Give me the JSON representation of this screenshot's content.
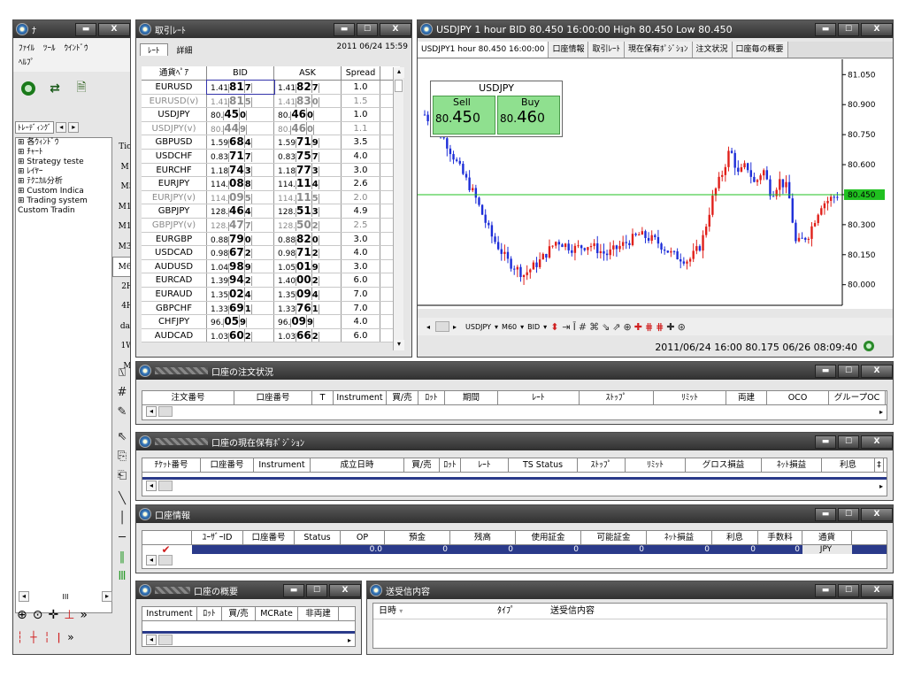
{
  "navigator": {
    "title": "ﾅ",
    "menu": [
      "ﾌｧｲﾙ",
      "ﾂｰﾙ",
      "ｳｲﾝﾄﾞｳ"
    ],
    "menu2": "ﾍﾙﾌﾟ",
    "tab": "ﾄﾚｰﾃﾞｨﾝｸﾞ",
    "tree": [
      "⊞ 各ｳｨﾝﾄﾞｳ",
      "⊞ ﾁｬｰﾄ",
      "⊞ Strategy teste",
      "⊞ ﾚｲﾔｰ",
      "⊞ ﾃｸﾆｶﾙ分析",
      "⊞ Custom Indica",
      "⊞ Trading system",
      "  Custom Tradin"
    ],
    "timeframes": [
      "Tick",
      "M1",
      "M5",
      "M10",
      "M15",
      "M30",
      "M60",
      "2H",
      "4H",
      "day",
      "1W",
      "M"
    ],
    "scroll_label": "III"
  },
  "rates": {
    "title": "取引ﾚｰﾄ",
    "tabs": [
      "ﾚｰﾄ",
      "詳細"
    ],
    "date": "2011 06/24 15:59",
    "headers": [
      "通貨ﾍﾟｱ",
      "BID",
      "ASK",
      "Spread"
    ],
    "rows": [
      {
        "pair": "EURUSD",
        "b1": "1.41",
        "b2": "81",
        "b3": "7",
        "a1": "1.41",
        "a2": "82",
        "a3": "7",
        "spread": "1.0",
        "grey": false
      },
      {
        "pair": "EURUSD(v)",
        "b1": "1.41",
        "b2": "81",
        "b3": "5",
        "a1": "1.41",
        "a2": "83",
        "a3": "0",
        "spread": "1.5",
        "grey": true
      },
      {
        "pair": "USDJPY",
        "b1": "80.",
        "b2": "45",
        "b3": "0",
        "a1": "80.",
        "a2": "46",
        "a3": "0",
        "spread": "1.0",
        "grey": false
      },
      {
        "pair": "USDJPY(v)",
        "b1": "80.",
        "b2": "44",
        "b3": "9",
        "a1": "80.",
        "a2": "46",
        "a3": "0",
        "spread": "1.1",
        "grey": true
      },
      {
        "pair": "GBPUSD",
        "b1": "1.59",
        "b2": "68",
        "b3": "4",
        "a1": "1.59",
        "a2": "71",
        "a3": "9",
        "spread": "3.5",
        "grey": false
      },
      {
        "pair": "USDCHF",
        "b1": "0.83",
        "b2": "71",
        "b3": "7",
        "a1": "0.83",
        "a2": "75",
        "a3": "7",
        "spread": "4.0",
        "grey": false
      },
      {
        "pair": "EURCHF",
        "b1": "1.18",
        "b2": "74",
        "b3": "3",
        "a1": "1.18",
        "a2": "77",
        "a3": "3",
        "spread": "3.0",
        "grey": false
      },
      {
        "pair": "EURJPY",
        "b1": "114.",
        "b2": "08",
        "b3": "8",
        "a1": "114.",
        "a2": "11",
        "a3": "4",
        "spread": "2.6",
        "grey": false
      },
      {
        "pair": "EURJPY(v)",
        "b1": "114.",
        "b2": "09",
        "b3": "5",
        "a1": "114.",
        "a2": "11",
        "a3": "5",
        "spread": "2.0",
        "grey": true
      },
      {
        "pair": "GBPJPY",
        "b1": "128.",
        "b2": "46",
        "b3": "4",
        "a1": "128.",
        "a2": "51",
        "a3": "3",
        "spread": "4.9",
        "grey": false
      },
      {
        "pair": "GBPJPY(v)",
        "b1": "128.",
        "b2": "47",
        "b3": "7",
        "a1": "128.",
        "a2": "50",
        "a3": "2",
        "spread": "2.5",
        "grey": true
      },
      {
        "pair": "EURGBP",
        "b1": "0.88",
        "b2": "79",
        "b3": "0",
        "a1": "0.88",
        "a2": "82",
        "a3": "0",
        "spread": "3.0",
        "grey": false
      },
      {
        "pair": "USDCAD",
        "b1": "0.98",
        "b2": "67",
        "b3": "2",
        "a1": "0.98",
        "a2": "71",
        "a3": "2",
        "spread": "4.0",
        "grey": false
      },
      {
        "pair": "AUDUSD",
        "b1": "1.04",
        "b2": "98",
        "b3": "9",
        "a1": "1.05",
        "a2": "01",
        "a3": "9",
        "spread": "3.0",
        "grey": false
      },
      {
        "pair": "EURCAD",
        "b1": "1.39",
        "b2": "94",
        "b3": "2",
        "a1": "1.40",
        "a2": "00",
        "a3": "2",
        "spread": "6.0",
        "grey": false
      },
      {
        "pair": "EURAUD",
        "b1": "1.35",
        "b2": "02",
        "b3": "4",
        "a1": "1.35",
        "a2": "09",
        "a3": "4",
        "spread": "7.0",
        "grey": false
      },
      {
        "pair": "GBPCHF",
        "b1": "1.33",
        "b2": "69",
        "b3": "1",
        "a1": "1.33",
        "a2": "76",
        "a3": "1",
        "spread": "7.0",
        "grey": false
      },
      {
        "pair": "CHFJPY",
        "b1": "96.",
        "b2": "05",
        "b3": "9",
        "a1": "96.",
        "a2": "09",
        "a3": "9",
        "spread": "4.0",
        "grey": false
      },
      {
        "pair": "AUDCAD",
        "b1": "1.03",
        "b2": "60",
        "b3": "2",
        "a1": "1.03",
        "a2": "66",
        "a3": "2",
        "spread": "6.0",
        "grey": false
      }
    ]
  },
  "chart": {
    "title": "USDJPY 1 hour BID 80.450 16:00:00 High 80.450 Low 80.450",
    "tabs": [
      "USDJPY1 hour 80.450 16:00:00",
      "口座情報",
      "取引ﾚｰﾄ",
      "現在保有ﾎﾟｼﾞｼｮﾝ",
      "注文状況",
      "口座毎の概要"
    ],
    "panel": {
      "symbol": "USDJPY",
      "sell_label": "Sell",
      "buy_label": "Buy",
      "sell_pre": "80.",
      "sell_big": "45",
      "sell_post": "0",
      "buy_pre": "80.",
      "buy_big": "46",
      "buy_post": "0"
    },
    "price_labels": [
      "81.050",
      "80.900",
      "80.750",
      "80.600",
      "80.450",
      "80.300",
      "80.150",
      "80.000"
    ],
    "current_price": "80.450",
    "date_labels": [
      "6.16",
      "6.17",
      "6.19",
      "11:00",
      "6.21 8:00",
      "6.22",
      "6.23",
      "6.24"
    ],
    "toolbar": {
      "symbol": "USDJPY",
      "tf": "M60",
      "price": "BID"
    },
    "status": "2011/06/24 16:00  80.175  06/26 08:09:40",
    "colors": {
      "up": "#e0201a",
      "down": "#1d2ed8",
      "hline": "#20c020",
      "marker": "#20c020"
    }
  },
  "orders": {
    "title": "口座の注文状況",
    "headers": [
      "注文番号",
      "口座番号",
      "T",
      "Instrument",
      "買/売",
      "ﾛｯﾄ",
      "期間",
      "ﾚｰﾄ",
      "ｽﾄｯﾌﾟ",
      "ﾘﾐｯﾄ",
      "両建",
      "OCO",
      "グループOC"
    ]
  },
  "positions": {
    "title": "口座の現在保有ﾎﾟｼﾞｼｮﾝ",
    "headers": [
      "ﾁｹｯﾄ番号",
      "口座番号",
      "Instrument",
      "成立日時",
      "買/売",
      "ﾛｯﾄ",
      "ﾚｰﾄ",
      "TS Status",
      "ｽﾄｯﾌﾟ",
      "ﾘﾐｯﾄ",
      "グロス損益",
      "ﾈｯﾄ損益",
      "利息",
      "‡"
    ]
  },
  "account": {
    "title": "口座情報",
    "headers": [
      "",
      "ﾕｰｻﾞｰID",
      "口座番号",
      "Status",
      "OP",
      "預金",
      "残高",
      "使用証金",
      "可能証金",
      "ﾈｯﾄ損益",
      "利息",
      "手数料",
      "通貨"
    ],
    "row": {
      "op": "0.0",
      "zero": "0",
      "currency": "JPY"
    }
  },
  "summary": {
    "title": "口座の概要",
    "headers": [
      "Instrument",
      "ﾛｯﾄ",
      "買/売",
      "MCRate",
      "非両建"
    ]
  },
  "messages": {
    "title": "送受信内容",
    "headers": [
      "日時",
      "ﾀｲﾌﾟ",
      "送受信内容"
    ]
  }
}
